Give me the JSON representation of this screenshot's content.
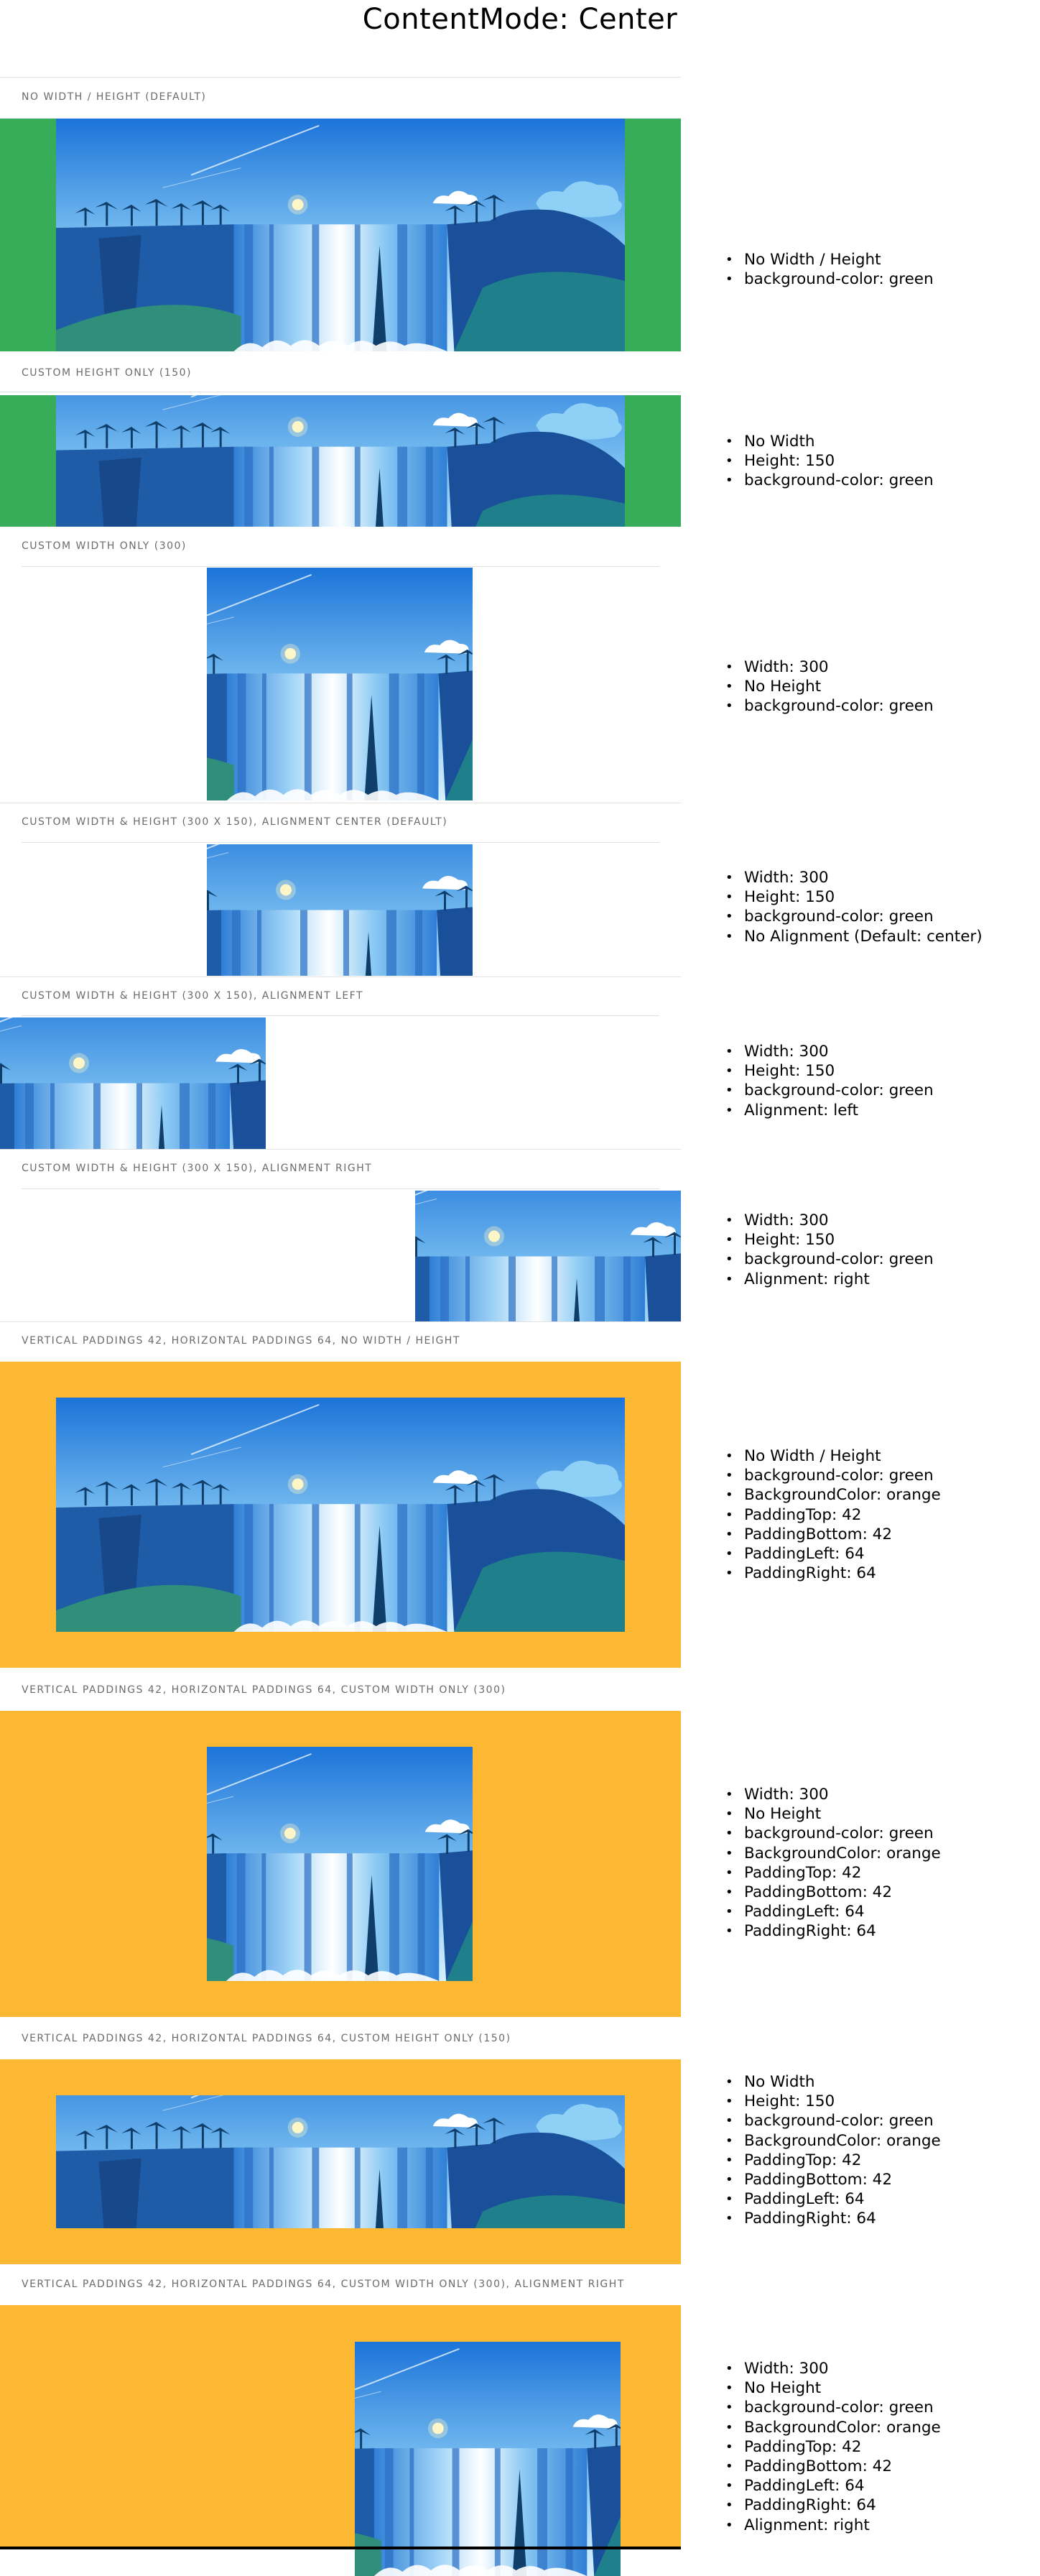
{
  "page": {
    "title": "ContentMode: Center"
  },
  "sections": [
    {
      "label": "NO WIDTH / HEIGHT (DEFAULT)",
      "background": "#37ad5a",
      "description": [
        "No Width / Height",
        "background-color: green"
      ]
    },
    {
      "label": "CUSTOM HEIGHT ONLY (150)",
      "background": "#37ad5a",
      "description": [
        "No Width",
        "Height: 150",
        "background-color: green"
      ]
    },
    {
      "label": "CUSTOM WIDTH ONLY (300)",
      "background": "#ffffff",
      "description": [
        "Width: 300",
        "No Height",
        "background-color: green"
      ]
    },
    {
      "label": "CUSTOM WIDTH & HEIGHT (300 X 150), ALIGNMENT CENTER (DEFAULT)",
      "background": "#ffffff",
      "description": [
        "Width: 300",
        "Height: 150",
        "background-color: green",
        "No Alignment (Default: center)"
      ]
    },
    {
      "label": "CUSTOM WIDTH & HEIGHT (300 X 150), ALIGNMENT LEFT",
      "background": "#ffffff",
      "description": [
        "Width: 300",
        "Height: 150",
        "background-color: green",
        "Alignment: left"
      ]
    },
    {
      "label": "CUSTOM WIDTH & HEIGHT (300 X 150), ALIGNMENT RIGHT",
      "background": "#ffffff",
      "description": [
        "Width: 300",
        "Height: 150",
        "background-color: green",
        "Alignment: right"
      ]
    },
    {
      "label": "VERTICAL PADDINGS 42, HORIZONTAL PADDINGS 64, NO WIDTH / HEIGHT",
      "background": "#fcb733",
      "description": [
        "No Width / Height",
        "background-color: green",
        "BackgroundColor: orange",
        "PaddingTop: 42",
        "PaddingBottom: 42",
        "PaddingLeft: 64",
        "PaddingRight: 64"
      ]
    },
    {
      "label": "VERTICAL PADDINGS 42, HORIZONTAL PADDINGS 64, CUSTOM WIDTH ONLY (300)",
      "background": "#fcb733",
      "description": [
        "Width: 300",
        "No Height",
        "background-color: green",
        "BackgroundColor: orange",
        "PaddingTop: 42",
        "PaddingBottom: 42",
        "PaddingLeft: 64",
        "PaddingRight: 64"
      ]
    },
    {
      "label": "VERTICAL PADDINGS 42, HORIZONTAL PADDINGS 64, CUSTOM HEIGHT ONLY (150)",
      "background": "#fcb733",
      "description": [
        "No Width",
        "Height: 150",
        "background-color: green",
        "BackgroundColor: orange",
        "PaddingTop: 42",
        "PaddingBottom: 42",
        "PaddingLeft: 64",
        "PaddingRight: 64"
      ]
    },
    {
      "label": "VERTICAL PADDINGS 42, HORIZONTAL PADDINGS 64, CUSTOM WIDTH ONLY (300), ALIGNMENT RIGHT",
      "background": "#fcb733",
      "description": [
        "Width: 300",
        "No Height",
        "background-color: green",
        "BackgroundColor: orange",
        "PaddingTop: 42",
        "PaddingBottom: 42",
        "PaddingLeft: 64",
        "PaddingRight: 64",
        "Alignment: right"
      ]
    }
  ]
}
